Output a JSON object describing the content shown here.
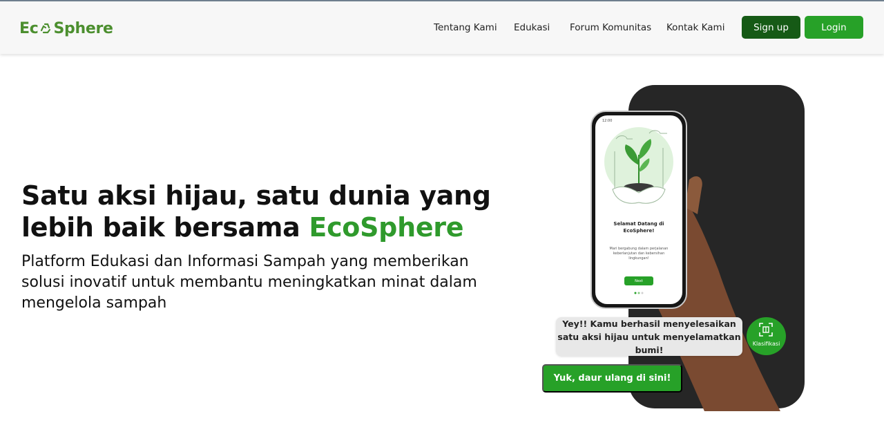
{
  "brand": {
    "logo_left": "Ec",
    "logo_right": "Sphere",
    "logo_icon": "recycle-icon",
    "color": "#4c8f2f"
  },
  "nav": {
    "links": [
      "Tentang Kami",
      "Edukasi",
      "Forum Komunitas",
      "Kontak Kami"
    ],
    "signup_label": "Sign up",
    "login_label": "Login"
  },
  "hero": {
    "headline_part1": "Satu aksi hijau, satu dunia yang lebih baik bersama ",
    "headline_brand": "EcoSphere",
    "subheadline": "Platform Edukasi dan Informasi Sampah yang memberikan solusi inovatif untuk membantu meningkatkan minat dalam mengelola sampah"
  },
  "phone": {
    "status_time": "12:00",
    "welcome_title": "Selamat Datang di EcoSphere!",
    "welcome_text": "Mari bergabung dalam perjalanan keberlanjutan dan kebersihan lingkungan!",
    "next_label": "Next"
  },
  "bubble": {
    "message": "Yey!! Kamu berhasil menyelesaikan satu aksi hijau untuk menyelamatkan bumi!"
  },
  "klasifikasi": {
    "label": "Klasifikasi",
    "icon": "scan-icon"
  },
  "cta": {
    "label": "Yuk, daur ulang di sini!"
  },
  "colors": {
    "primary_green": "#27a128",
    "dark_green": "#165a16",
    "brand_text_green": "#2f9a2c",
    "dark_panel": "#262626"
  }
}
